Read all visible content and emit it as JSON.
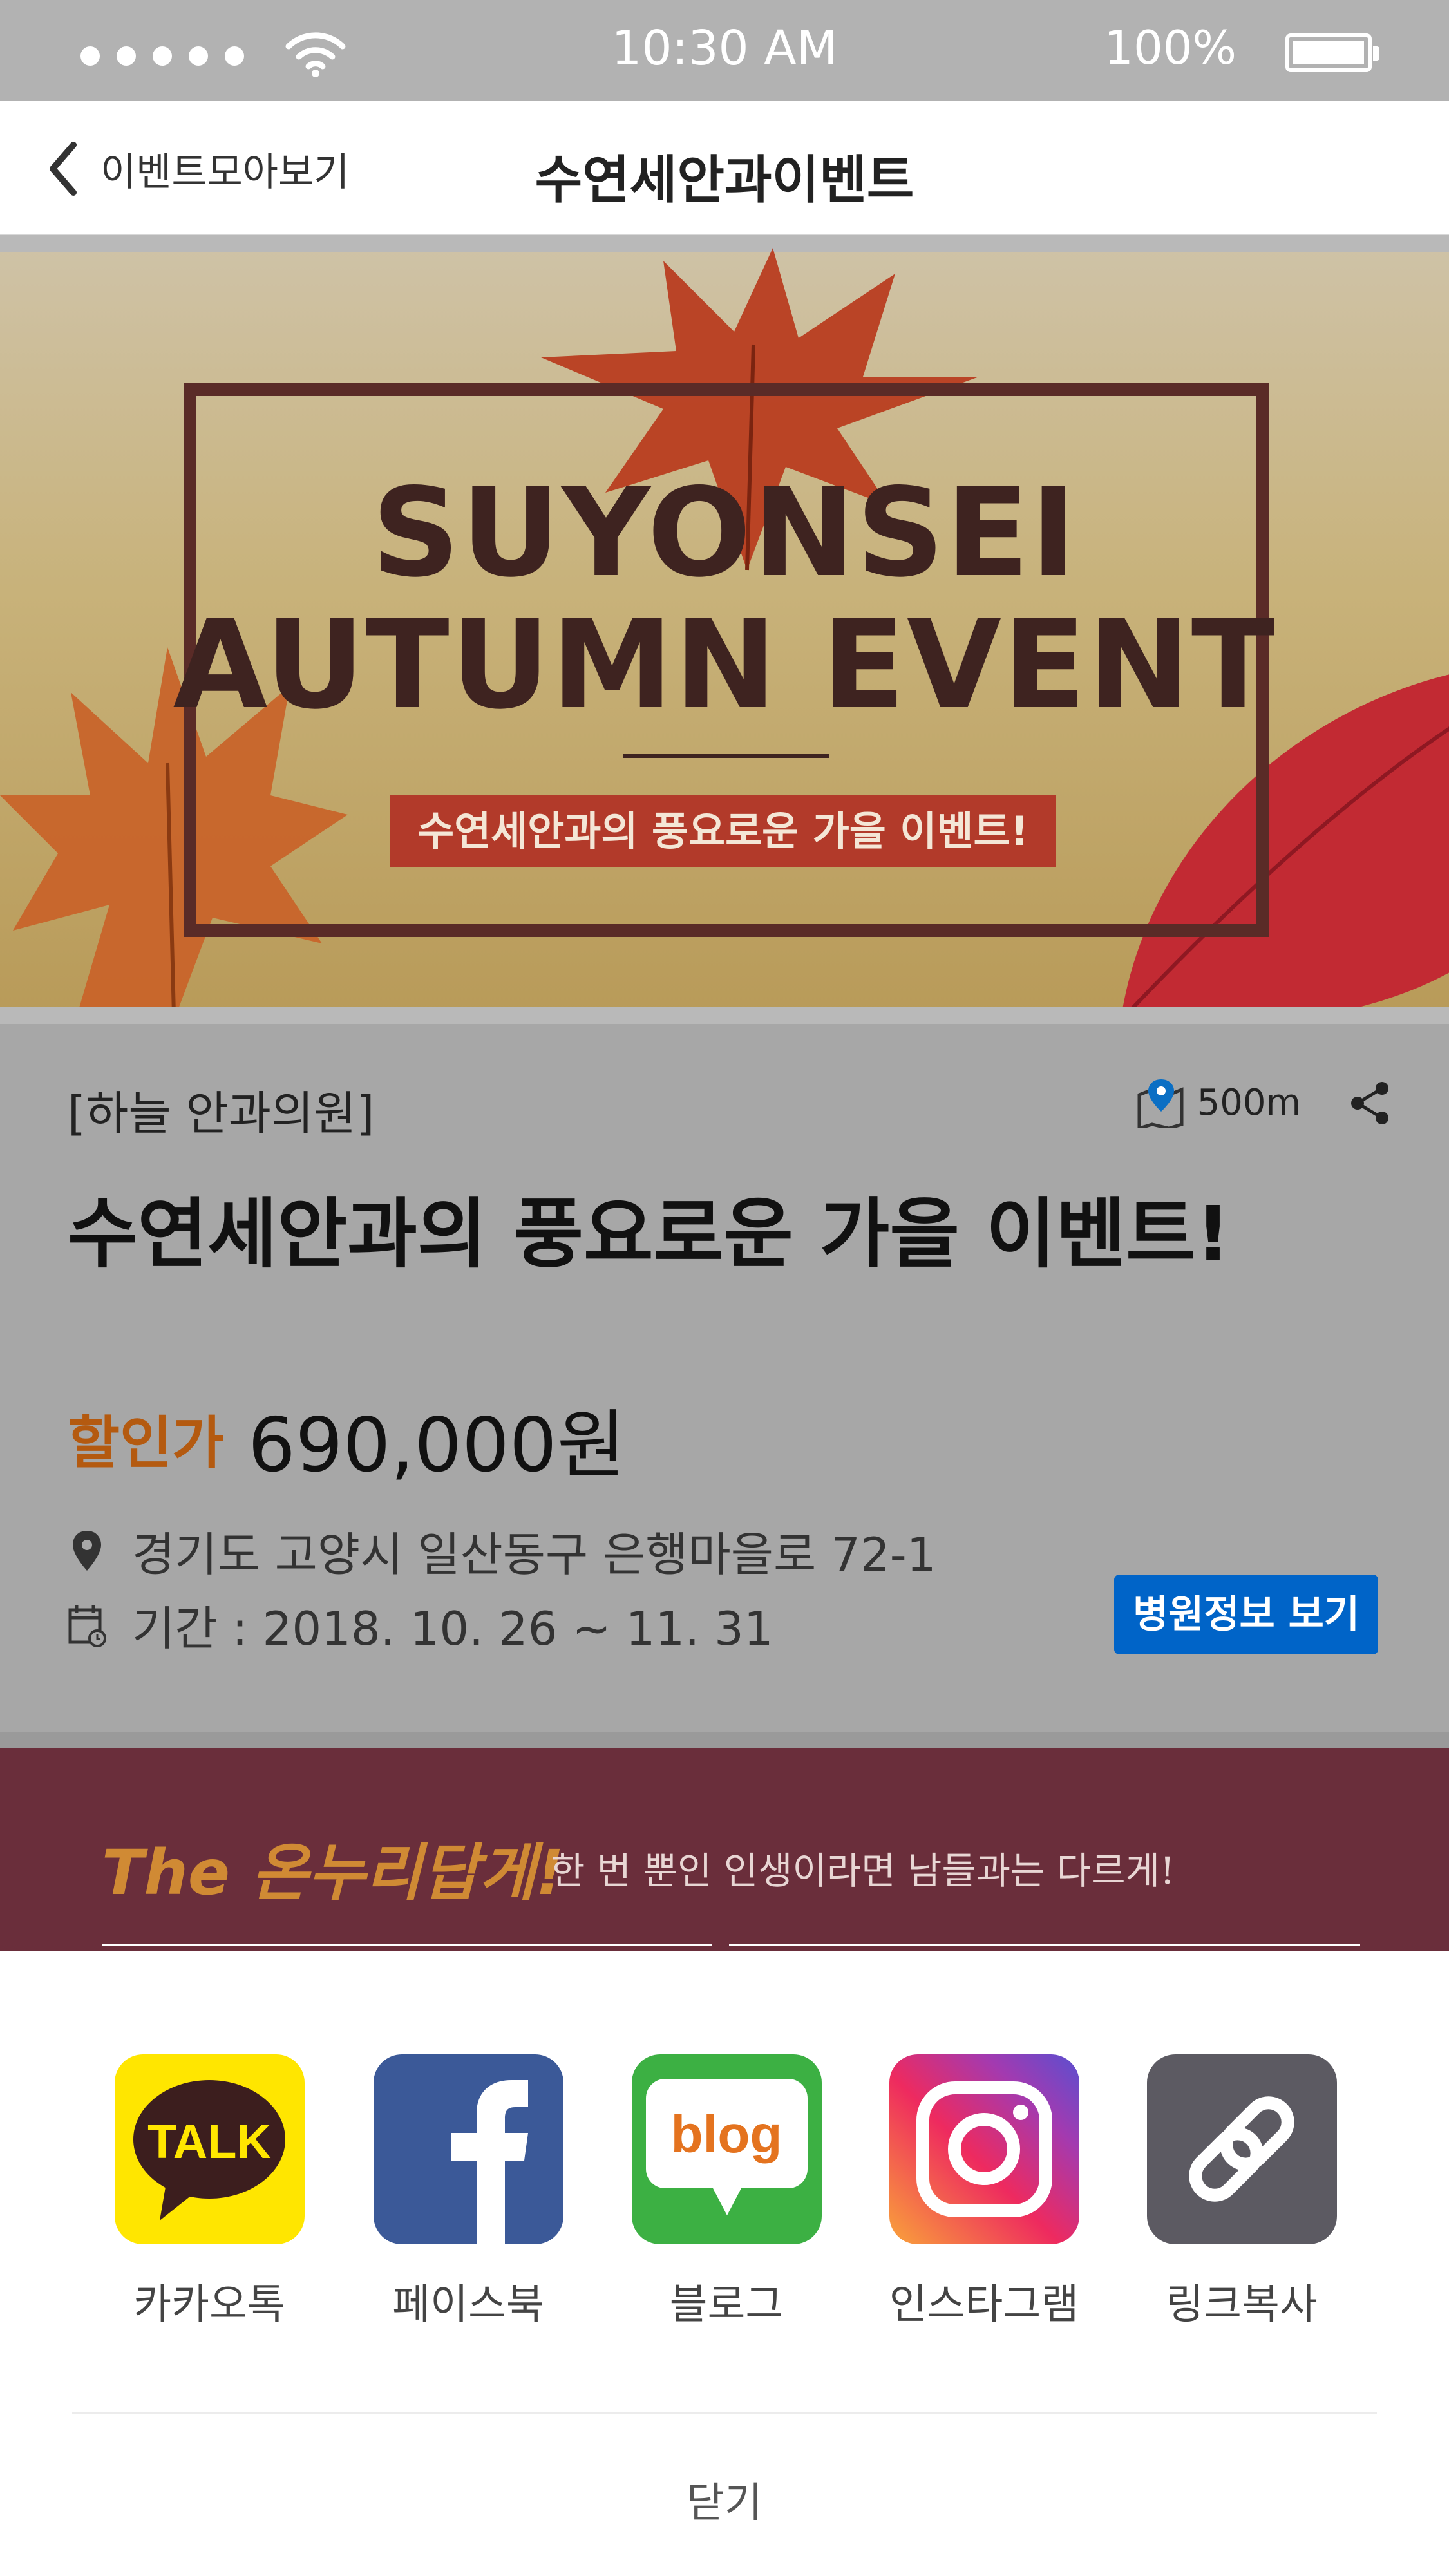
{
  "status_bar": {
    "time": "10:30 AM",
    "battery": "100%"
  },
  "nav": {
    "back_label": "이벤트모아보기",
    "title": "수연세안과이벤트"
  },
  "banner": {
    "title_line1": "SUYONSEI",
    "title_line2": "AUTUMN EVENT",
    "subtitle": "수연세안과의 풍요로운 가을 이벤트!"
  },
  "event": {
    "hospital": "[하늘 안과의원]",
    "distance": "500m",
    "title": "수연세안과의 풍요로운 가을 이벤트!",
    "price_label": "할인가",
    "price": "690,000원",
    "address": "경기도 고양시 일산동구 은행마을로 72-1",
    "period": "기간 : 2018. 10. 26 ~ 11. 31",
    "hospital_button": "병원정보 보기"
  },
  "promo": {
    "brand": "The 온누리답게!",
    "tagline": "한 번 뿐인 인생이라면 남들과는 다르게!"
  },
  "share_sheet": {
    "items": [
      {
        "label": "카카오톡",
        "icon": "kakaotalk-icon",
        "icon_text": "TALK",
        "color": "#ffe600"
      },
      {
        "label": "페이스북",
        "icon": "facebook-icon",
        "color": "#3b5998"
      },
      {
        "label": "블로그",
        "icon": "blog-icon",
        "icon_text": "blog",
        "color": "#3cb043"
      },
      {
        "label": "인스타그램",
        "icon": "instagram-icon",
        "color": "#d6287a"
      },
      {
        "label": "링크복사",
        "icon": "link-icon",
        "color": "#5c5a62"
      }
    ],
    "close_label": "닫기"
  },
  "colors": {
    "accent_blue": "#0064c8",
    "price_orange": "#b45a10",
    "promo_bg": "#6a2e3b"
  }
}
